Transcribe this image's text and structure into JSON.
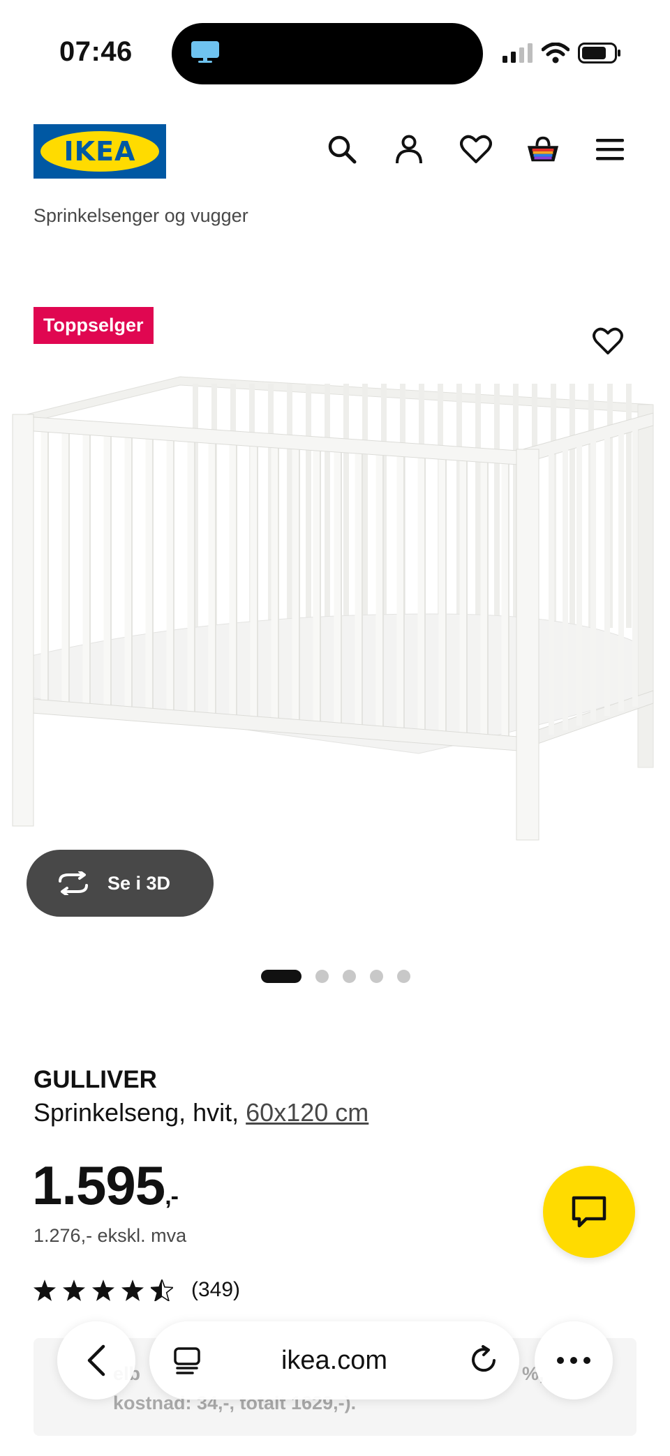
{
  "status_bar": {
    "time": "07:46"
  },
  "header": {
    "logo_text": "IKEA",
    "icons": [
      "search-icon",
      "account-icon",
      "heart-icon",
      "basket-icon",
      "menu-icon"
    ]
  },
  "breadcrumb": "Sprinkelsenger og vugger",
  "gallery": {
    "badge": "Toppselger",
    "view_3d_label": "Se i 3D",
    "slide_count": 5,
    "active_slide": 1
  },
  "product": {
    "name": "GULLIVER",
    "description": "Sprinkelseng, hvit, ",
    "size_link": "60x120 cm",
    "price_main": "1.595",
    "price_suffix": ",-",
    "price_ex_vat": "1.276,- ekskl. mva",
    "rating_stars": 4.5,
    "review_count": "(349)"
  },
  "financing": {
    "line1_fragment": "elb",
    "line1_end": "%,",
    "line2": "kostnad: 34,-, totalt 1629,-)."
  },
  "browser": {
    "url": "ikea.com"
  },
  "colors": {
    "ikea_blue": "#0058a3",
    "ikea_yellow": "#ffdb00",
    "badge_red": "#e00751",
    "dark_button": "#484848"
  }
}
